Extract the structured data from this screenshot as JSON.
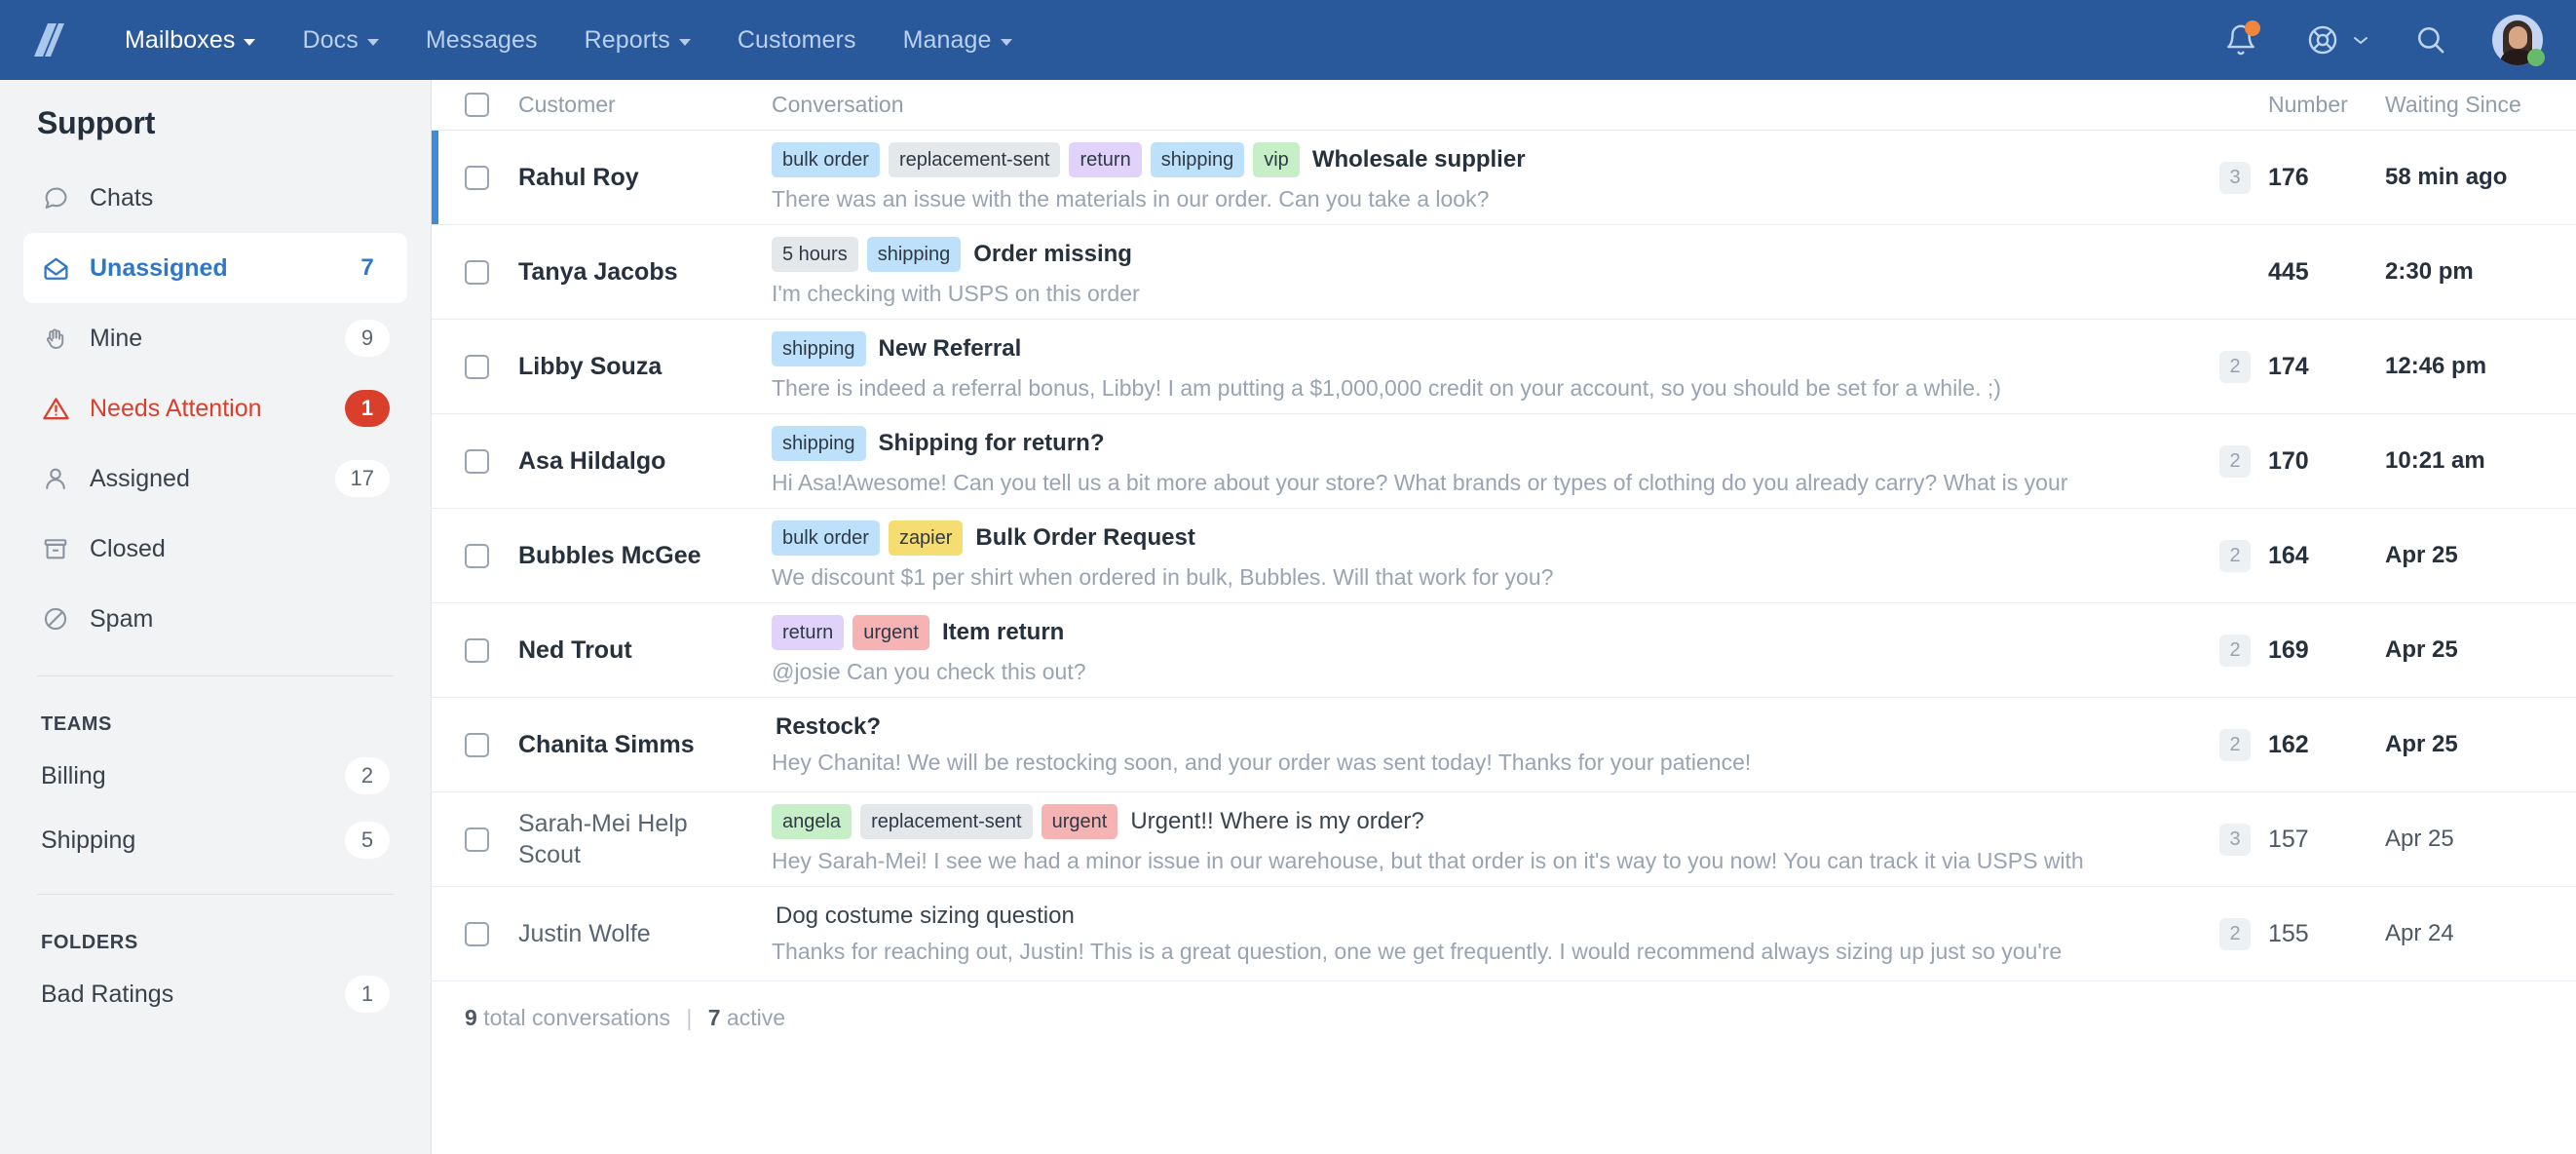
{
  "topnav": {
    "brand": "helpscout-logo",
    "items": [
      {
        "label": "Mailboxes",
        "caret": true,
        "active": true
      },
      {
        "label": "Docs",
        "caret": true,
        "active": false
      },
      {
        "label": "Messages",
        "caret": false,
        "active": false
      },
      {
        "label": "Reports",
        "caret": true,
        "active": false
      },
      {
        "label": "Customers",
        "caret": false,
        "active": false
      },
      {
        "label": "Manage",
        "caret": true,
        "active": false
      }
    ],
    "notifications_icon": "bell-icon",
    "has_notification": true,
    "help_icon": "lifebuoy-icon",
    "search_icon": "search-icon",
    "avatar": "user-avatar",
    "presence": "online"
  },
  "sidebar": {
    "title": "Support",
    "folders": [
      {
        "label": "Chats",
        "icon": "chat-bubble-icon",
        "count": "",
        "state": "normal",
        "selected": false
      },
      {
        "label": "Unassigned",
        "icon": "open-envelope-icon",
        "count": "7",
        "state": "normal",
        "selected": true
      },
      {
        "label": "Mine",
        "icon": "hand-icon",
        "count": "9",
        "state": "normal",
        "selected": false
      },
      {
        "label": "Needs Attention",
        "icon": "warning-icon",
        "count": "1",
        "state": "alert",
        "selected": false
      },
      {
        "label": "Assigned",
        "icon": "person-icon",
        "count": "17",
        "state": "normal",
        "selected": false
      },
      {
        "label": "Closed",
        "icon": "archive-icon",
        "count": "",
        "state": "normal",
        "selected": false
      },
      {
        "label": "Spam",
        "icon": "no-entry-icon",
        "count": "",
        "state": "normal",
        "selected": false
      }
    ],
    "teams_header": "TEAMS",
    "teams": [
      {
        "label": "Billing",
        "count": "2"
      },
      {
        "label": "Shipping",
        "count": "5"
      }
    ],
    "folders_header": "FOLDERS",
    "custom_folders": [
      {
        "label": "Bad Ratings",
        "count": "1"
      }
    ]
  },
  "list": {
    "columns": {
      "customer": "Customer",
      "conversation": "Conversation",
      "number": "Number",
      "waiting_since": "Waiting Since"
    },
    "rows": [
      {
        "customer": "Rahul Roy",
        "tags": [
          {
            "label": "bulk order",
            "color": "#bde1fa"
          },
          {
            "label": "replacement-sent",
            "color": "#e5e8eb"
          },
          {
            "label": "return",
            "color": "#e0d2fa"
          },
          {
            "label": "shipping",
            "color": "#bde1fa"
          },
          {
            "label": "vip",
            "color": "#c6efc8"
          }
        ],
        "subject": "Wholesale supplier",
        "preview": "There was an issue with the materials in our order. Can you take a look?",
        "threads": "3",
        "number": "176",
        "waiting_since": "58 min ago",
        "active": true,
        "read": false
      },
      {
        "customer": "Tanya Jacobs",
        "tags": [
          {
            "label": "5 hours",
            "color": "#e5e8eb"
          },
          {
            "label": "shipping",
            "color": "#bde1fa"
          }
        ],
        "subject": "Order missing",
        "preview": "I'm checking with USPS on this order",
        "threads": "",
        "number": "445",
        "waiting_since": "2:30 pm",
        "active": false,
        "read": false
      },
      {
        "customer": "Libby Souza",
        "tags": [
          {
            "label": "shipping",
            "color": "#bde1fa"
          }
        ],
        "subject": "New Referral",
        "preview": "There is indeed a referral bonus, Libby! I am putting a $1,000,000 credit on your account, so you should be set for a while. ;)",
        "threads": "2",
        "number": "174",
        "waiting_since": "12:46 pm",
        "active": false,
        "read": false
      },
      {
        "customer": "Asa Hildalgo",
        "tags": [
          {
            "label": "shipping",
            "color": "#bde1fa"
          }
        ],
        "subject": "Shipping for return?",
        "preview": "Hi Asa!Awesome! Can you tell us a bit more about your store? What brands or types of clothing do you already carry? What is your",
        "threads": "2",
        "number": "170",
        "waiting_since": "10:21 am",
        "active": false,
        "read": false
      },
      {
        "customer": "Bubbles McGee",
        "tags": [
          {
            "label": "bulk order",
            "color": "#bde1fa"
          },
          {
            "label": "zapier",
            "color": "#f5dd72"
          }
        ],
        "subject": "Bulk Order Request",
        "preview": "We discount $1 per shirt when ordered in bulk, Bubbles. Will that work for you?",
        "threads": "2",
        "number": "164",
        "waiting_since": "Apr 25",
        "active": false,
        "read": false
      },
      {
        "customer": "Ned Trout",
        "tags": [
          {
            "label": "return",
            "color": "#e0d2fa"
          },
          {
            "label": "urgent",
            "color": "#f5b3b3"
          }
        ],
        "subject": "Item return",
        "preview": "@josie Can  you check this out?",
        "threads": "2",
        "number": "169",
        "waiting_since": "Apr 25",
        "active": false,
        "read": false
      },
      {
        "customer": "Chanita Simms",
        "tags": [],
        "subject": "Restock?",
        "preview": "Hey Chanita! We will be restocking soon, and your order was sent today! Thanks for your patience!",
        "threads": "2",
        "number": "162",
        "waiting_since": "Apr 25",
        "active": false,
        "read": false
      },
      {
        "customer": "Sarah-Mei Help Scout",
        "tags": [
          {
            "label": "angela",
            "color": "#c6efc8"
          },
          {
            "label": "replacement-sent",
            "color": "#e5e8eb"
          },
          {
            "label": "urgent",
            "color": "#f5b3b3"
          }
        ],
        "subject": "Urgent!! Where is my order?",
        "preview": "Hey Sarah-Mei! I see we had a minor issue in our warehouse, but that order is on it's way to you now! You can track it via USPS with",
        "threads": "3",
        "number": "157",
        "waiting_since": "Apr 25",
        "active": false,
        "read": true
      },
      {
        "customer": "Justin Wolfe",
        "tags": [],
        "subject": "Dog costume sizing question",
        "preview": "Thanks for reaching out, Justin! This is a great question, one we get frequently. I would recommend always sizing up just so you're",
        "threads": "2",
        "number": "155",
        "waiting_since": "Apr 24",
        "active": false,
        "read": true
      }
    ],
    "footer": {
      "total_count": "9",
      "total_label": "total conversations",
      "separator": "|",
      "active_count": "7",
      "active_label": "active"
    }
  },
  "colors": {
    "brand_blue": "#29589b",
    "accent_blue": "#3077c6",
    "alert_red": "#d93f2b",
    "sidebar_bg": "#f1f3f5",
    "online_green": "#66bb6a",
    "notif_orange": "#f0873c"
  }
}
